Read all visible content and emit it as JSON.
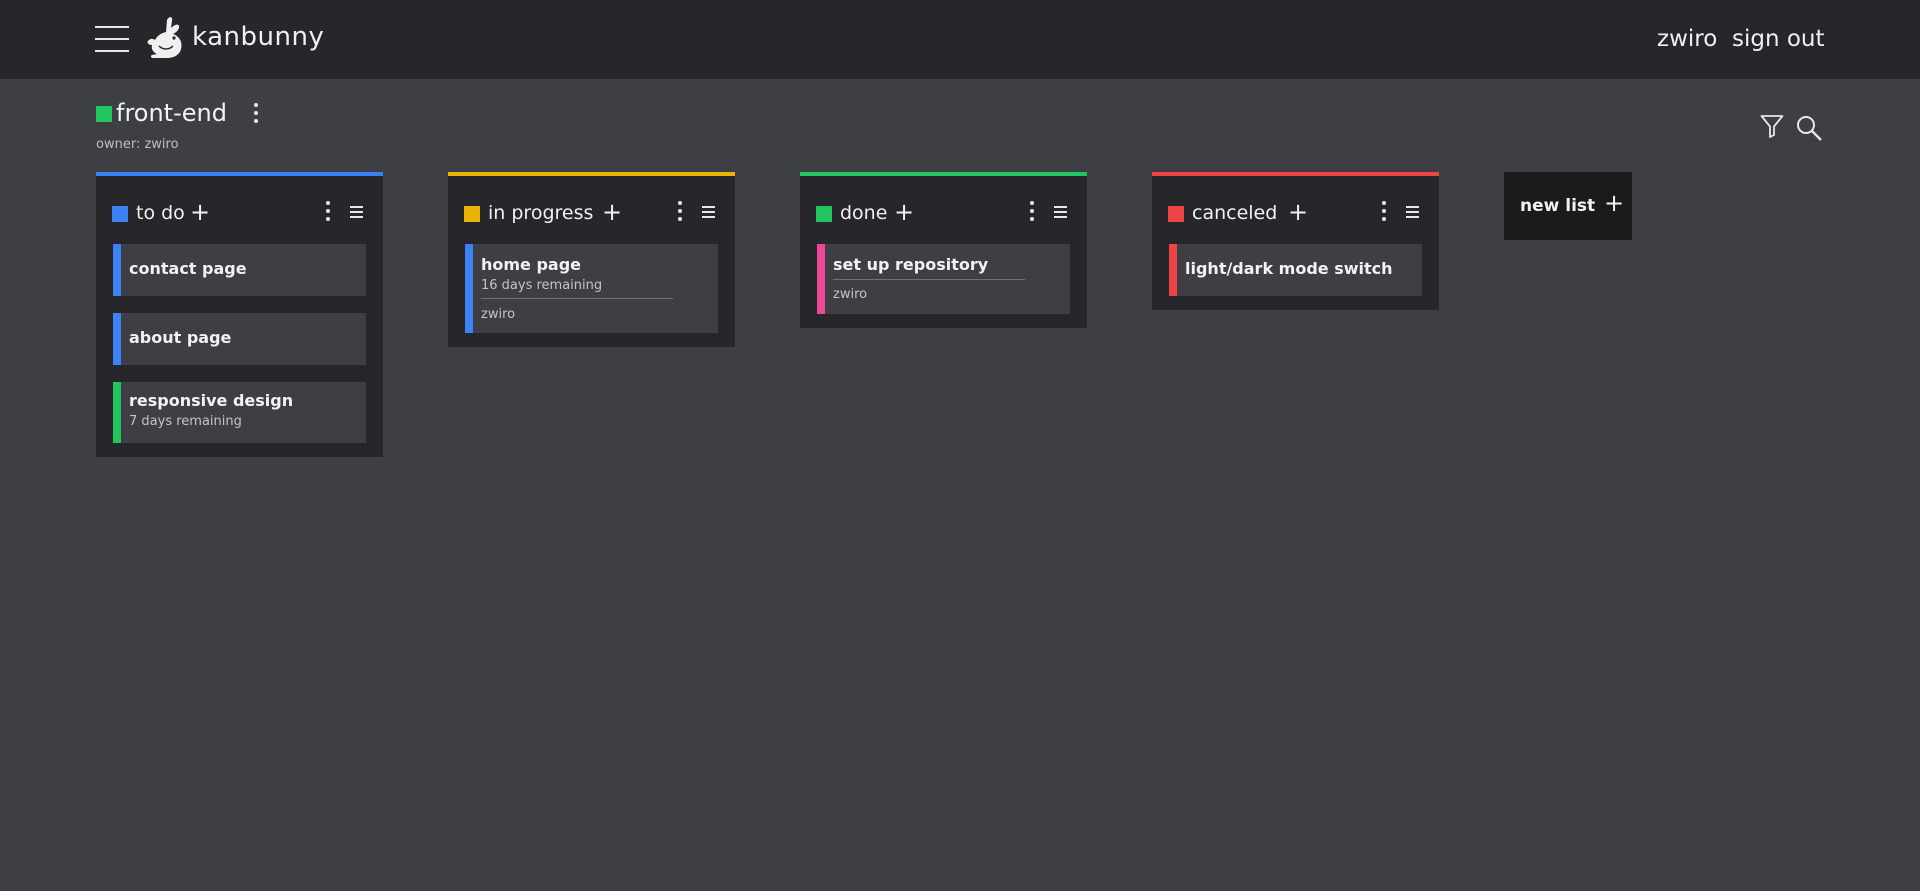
{
  "app": {
    "brand": "kanbunny"
  },
  "nav": {
    "user": "zwiro",
    "sign_out": "sign out"
  },
  "board": {
    "title": "front-end",
    "owner_label": "owner: zwiro",
    "color": "#22c55e"
  },
  "icons": {
    "menu": "hamburger-menu-icon",
    "logo": "rabbit-logo-icon",
    "filter": "filter-icon",
    "search": "search-icon",
    "more": "kebab-menu-icon",
    "list_menu": "list-menu-icon",
    "add": "plus-icon"
  },
  "lists": [
    {
      "title": "to do",
      "color": "#3b82f6",
      "cards": [
        {
          "title": "contact page",
          "color": "#3b82f6"
        },
        {
          "title": "about page",
          "color": "#3b82f6"
        },
        {
          "title": "responsive design",
          "subtitle": "7 days remaining",
          "color": "#22c55e"
        }
      ]
    },
    {
      "title": "in progress",
      "color": "#eab308",
      "cards": [
        {
          "title": "home page",
          "subtitle": "16 days remaining",
          "assignee": "zwiro",
          "color": "#3b82f6"
        }
      ]
    },
    {
      "title": "done",
      "color": "#22c55e",
      "cards": [
        {
          "title": "set up repository",
          "assignee": "zwiro",
          "color": "#ec4899"
        }
      ]
    },
    {
      "title": "canceled",
      "color": "#ef4444",
      "cards": [
        {
          "title": "light/dark mode switch",
          "color": "#ef4444"
        }
      ]
    }
  ],
  "new_list": {
    "label": "new list"
  }
}
